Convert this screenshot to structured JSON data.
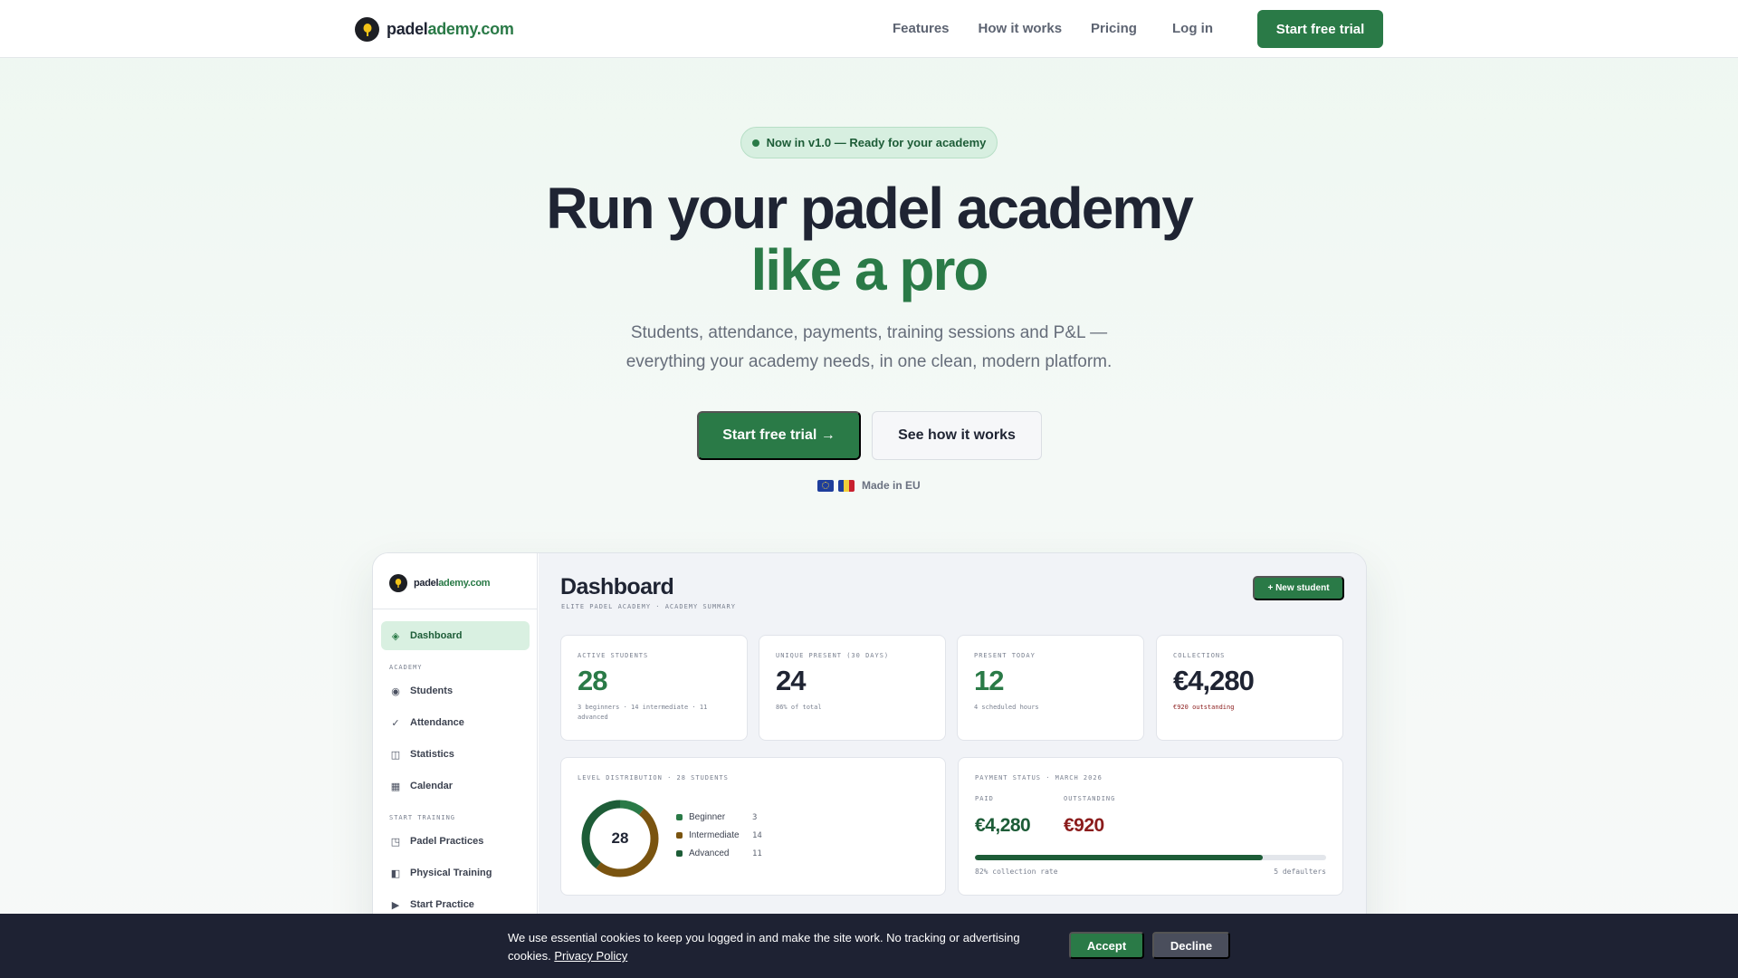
{
  "brand": {
    "part1": "padel",
    "part2": "ademy.com"
  },
  "nav": {
    "links": [
      "Features",
      "How it works",
      "Pricing"
    ],
    "login": "Log in",
    "cta": "Start free trial"
  },
  "hero": {
    "badge": "Now in v1.0 — Ready for your academy",
    "title_line1": "Run your padel academy",
    "title_line2": "like a pro",
    "subtitle_line1": "Students, attendance, payments, training sessions and P&L —",
    "subtitle_line2": "everything your academy needs, in one clean, modern platform.",
    "cta_primary": "Start free trial →",
    "cta_secondary": "See how it works",
    "made_in": "Made in EU"
  },
  "dashboard": {
    "brand": {
      "part1": "padel",
      "part2": "ademy.com"
    },
    "sidebar": {
      "items": [
        {
          "label": "Dashboard",
          "icon": "diamond-icon"
        },
        {
          "label": "Students",
          "icon": "circle-icon"
        },
        {
          "label": "Attendance",
          "icon": "check-icon"
        },
        {
          "label": "Statistics",
          "icon": "grid-icon"
        },
        {
          "label": "Calendar",
          "icon": "calendar-icon"
        },
        {
          "label": "Padel Practices",
          "icon": "court-icon"
        },
        {
          "label": "Physical Training",
          "icon": "dumbbell-icon"
        },
        {
          "label": "Start Practice",
          "icon": "play-icon"
        }
      ],
      "section_academy": "ACADEMY",
      "section_training": "START TRAINING"
    },
    "title": "Dashboard",
    "subtitle": "ELITE PADEL ACADEMY · ACADEMY SUMMARY",
    "new_button": "+ New student",
    "stats": [
      {
        "label": "ACTIVE STUDENTS",
        "value": "28",
        "note": "3 beginners · 14 intermediate · 11 advanced"
      },
      {
        "label": "UNIQUE PRESENT (30 DAYS)",
        "value": "24",
        "note": "86% of total"
      },
      {
        "label": "PRESENT TODAY",
        "value": "12",
        "note": "4 scheduled hours"
      },
      {
        "label": "COLLECTIONS",
        "value": "€4,280",
        "note": "€920 outstanding"
      }
    ],
    "levels": {
      "label": "LEVEL DISTRIBUTION · 28 STUDENTS",
      "total": "28",
      "rows": [
        {
          "name": "Beginner",
          "value": 3,
          "color": "#2a7a47"
        },
        {
          "name": "Intermediate",
          "value": 14,
          "color": "#7a5410"
        },
        {
          "name": "Advanced",
          "value": 11,
          "color": "#1d5c37"
        }
      ]
    },
    "payments": {
      "label": "PAYMENT STATUS · MARCH 2026",
      "paid_label": "PAID",
      "paid_value": "€4,280",
      "outstanding_label": "OUTSTANDING",
      "outstanding_value": "€920",
      "collection_rate": 0.82,
      "rate_text": "82% collection rate",
      "defaulters_text": "5 defaulters"
    }
  },
  "cookie": {
    "text": "We use essential cookies to keep you logged in and make the site work. No tracking or advertising cookies.",
    "policy": "Privacy Policy",
    "accept": "Accept",
    "decline": "Decline"
  },
  "colors": {
    "accent": "#2a7a47",
    "dark": "#1f2433",
    "danger": "#8b1c1c",
    "brown": "#7a5410"
  }
}
